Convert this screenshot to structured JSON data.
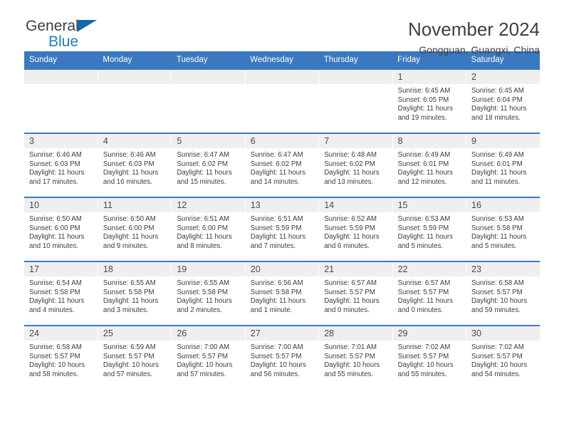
{
  "brand": {
    "name_line1": "General",
    "name_line2": "Blue",
    "accent_color": "#1567ad",
    "blue_text_color": "#1f7ec4"
  },
  "header": {
    "title": "November 2024",
    "subtitle": "Gongguan, Guangxi, China"
  },
  "calendar": {
    "header_bg": "#3a79c0",
    "daynum_bg": "#efefef",
    "weekdays": [
      "Sunday",
      "Monday",
      "Tuesday",
      "Wednesday",
      "Thursday",
      "Friday",
      "Saturday"
    ],
    "weeks": [
      [
        {
          "day": "",
          "sunrise": "",
          "sunset": "",
          "daylight": "",
          "blank": true
        },
        {
          "day": "",
          "sunrise": "",
          "sunset": "",
          "daylight": "",
          "blank": true
        },
        {
          "day": "",
          "sunrise": "",
          "sunset": "",
          "daylight": "",
          "blank": true
        },
        {
          "day": "",
          "sunrise": "",
          "sunset": "",
          "daylight": "",
          "blank": true
        },
        {
          "day": "",
          "sunrise": "",
          "sunset": "",
          "daylight": "",
          "blank": true
        },
        {
          "day": "1",
          "sunrise": "Sunrise: 6:45 AM",
          "sunset": "Sunset: 6:05 PM",
          "daylight": "Daylight: 11 hours and 19 minutes."
        },
        {
          "day": "2",
          "sunrise": "Sunrise: 6:45 AM",
          "sunset": "Sunset: 6:04 PM",
          "daylight": "Daylight: 11 hours and 18 minutes."
        }
      ],
      [
        {
          "day": "3",
          "sunrise": "Sunrise: 6:46 AM",
          "sunset": "Sunset: 6:03 PM",
          "daylight": "Daylight: 11 hours and 17 minutes."
        },
        {
          "day": "4",
          "sunrise": "Sunrise: 6:46 AM",
          "sunset": "Sunset: 6:03 PM",
          "daylight": "Daylight: 11 hours and 16 minutes."
        },
        {
          "day": "5",
          "sunrise": "Sunrise: 6:47 AM",
          "sunset": "Sunset: 6:02 PM",
          "daylight": "Daylight: 11 hours and 15 minutes."
        },
        {
          "day": "6",
          "sunrise": "Sunrise: 6:47 AM",
          "sunset": "Sunset: 6:02 PM",
          "daylight": "Daylight: 11 hours and 14 minutes."
        },
        {
          "day": "7",
          "sunrise": "Sunrise: 6:48 AM",
          "sunset": "Sunset: 6:02 PM",
          "daylight": "Daylight: 11 hours and 13 minutes."
        },
        {
          "day": "8",
          "sunrise": "Sunrise: 6:49 AM",
          "sunset": "Sunset: 6:01 PM",
          "daylight": "Daylight: 11 hours and 12 minutes."
        },
        {
          "day": "9",
          "sunrise": "Sunrise: 6:49 AM",
          "sunset": "Sunset: 6:01 PM",
          "daylight": "Daylight: 11 hours and 11 minutes."
        }
      ],
      [
        {
          "day": "10",
          "sunrise": "Sunrise: 6:50 AM",
          "sunset": "Sunset: 6:00 PM",
          "daylight": "Daylight: 11 hours and 10 minutes."
        },
        {
          "day": "11",
          "sunrise": "Sunrise: 6:50 AM",
          "sunset": "Sunset: 6:00 PM",
          "daylight": "Daylight: 11 hours and 9 minutes."
        },
        {
          "day": "12",
          "sunrise": "Sunrise: 6:51 AM",
          "sunset": "Sunset: 6:00 PM",
          "daylight": "Daylight: 11 hours and 8 minutes."
        },
        {
          "day": "13",
          "sunrise": "Sunrise: 6:51 AM",
          "sunset": "Sunset: 5:59 PM",
          "daylight": "Daylight: 11 hours and 7 minutes."
        },
        {
          "day": "14",
          "sunrise": "Sunrise: 6:52 AM",
          "sunset": "Sunset: 5:59 PM",
          "daylight": "Daylight: 11 hours and 6 minutes."
        },
        {
          "day": "15",
          "sunrise": "Sunrise: 6:53 AM",
          "sunset": "Sunset: 5:59 PM",
          "daylight": "Daylight: 11 hours and 5 minutes."
        },
        {
          "day": "16",
          "sunrise": "Sunrise: 6:53 AM",
          "sunset": "Sunset: 5:58 PM",
          "daylight": "Daylight: 11 hours and 5 minutes."
        }
      ],
      [
        {
          "day": "17",
          "sunrise": "Sunrise: 6:54 AM",
          "sunset": "Sunset: 5:58 PM",
          "daylight": "Daylight: 11 hours and 4 minutes."
        },
        {
          "day": "18",
          "sunrise": "Sunrise: 6:55 AM",
          "sunset": "Sunset: 5:58 PM",
          "daylight": "Daylight: 11 hours and 3 minutes."
        },
        {
          "day": "19",
          "sunrise": "Sunrise: 6:55 AM",
          "sunset": "Sunset: 5:58 PM",
          "daylight": "Daylight: 11 hours and 2 minutes."
        },
        {
          "day": "20",
          "sunrise": "Sunrise: 6:56 AM",
          "sunset": "Sunset: 5:58 PM",
          "daylight": "Daylight: 11 hours and 1 minute."
        },
        {
          "day": "21",
          "sunrise": "Sunrise: 6:57 AM",
          "sunset": "Sunset: 5:57 PM",
          "daylight": "Daylight: 11 hours and 0 minutes."
        },
        {
          "day": "22",
          "sunrise": "Sunrise: 6:57 AM",
          "sunset": "Sunset: 5:57 PM",
          "daylight": "Daylight: 11 hours and 0 minutes."
        },
        {
          "day": "23",
          "sunrise": "Sunrise: 6:58 AM",
          "sunset": "Sunset: 5:57 PM",
          "daylight": "Daylight: 10 hours and 59 minutes."
        }
      ],
      [
        {
          "day": "24",
          "sunrise": "Sunrise: 6:58 AM",
          "sunset": "Sunset: 5:57 PM",
          "daylight": "Daylight: 10 hours and 58 minutes."
        },
        {
          "day": "25",
          "sunrise": "Sunrise: 6:59 AM",
          "sunset": "Sunset: 5:57 PM",
          "daylight": "Daylight: 10 hours and 57 minutes."
        },
        {
          "day": "26",
          "sunrise": "Sunrise: 7:00 AM",
          "sunset": "Sunset: 5:57 PM",
          "daylight": "Daylight: 10 hours and 57 minutes."
        },
        {
          "day": "27",
          "sunrise": "Sunrise: 7:00 AM",
          "sunset": "Sunset: 5:57 PM",
          "daylight": "Daylight: 10 hours and 56 minutes."
        },
        {
          "day": "28",
          "sunrise": "Sunrise: 7:01 AM",
          "sunset": "Sunset: 5:57 PM",
          "daylight": "Daylight: 10 hours and 55 minutes."
        },
        {
          "day": "29",
          "sunrise": "Sunrise: 7:02 AM",
          "sunset": "Sunset: 5:57 PM",
          "daylight": "Daylight: 10 hours and 55 minutes."
        },
        {
          "day": "30",
          "sunrise": "Sunrise: 7:02 AM",
          "sunset": "Sunset: 5:57 PM",
          "daylight": "Daylight: 10 hours and 54 minutes."
        }
      ]
    ]
  }
}
